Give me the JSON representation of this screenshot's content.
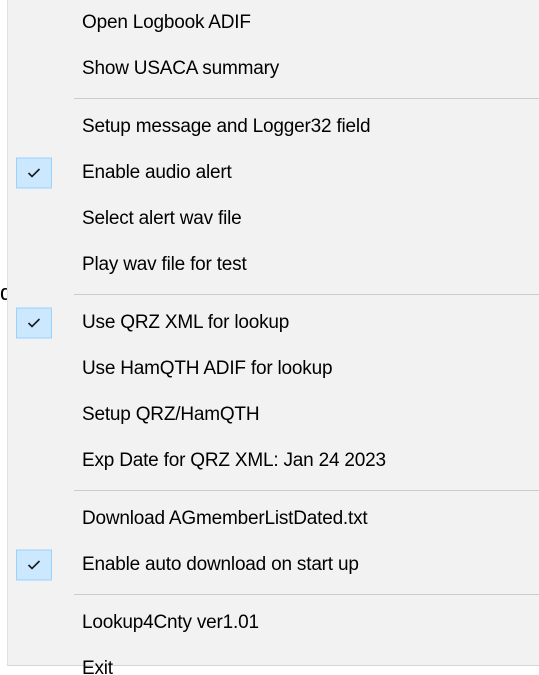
{
  "background": {
    "fragment_text": "d"
  },
  "menu": {
    "groups": [
      {
        "items": [
          {
            "label": "Open Logbook ADIF",
            "checked": false
          },
          {
            "label": "Show USACA summary",
            "checked": false
          }
        ]
      },
      {
        "items": [
          {
            "label": "Setup message and Logger32 field",
            "checked": false
          },
          {
            "label": "Enable audio alert",
            "checked": true
          },
          {
            "label": "Select alert wav file",
            "checked": false
          },
          {
            "label": "Play wav file for test",
            "checked": false
          }
        ]
      },
      {
        "items": [
          {
            "label": "Use QRZ XML for lookup",
            "checked": true
          },
          {
            "label": "Use HamQTH ADIF for lookup",
            "checked": false
          },
          {
            "label": "Setup QRZ/HamQTH",
            "checked": false
          },
          {
            "label": "Exp Date for QRZ XML: Jan 24 2023",
            "checked": false
          }
        ]
      },
      {
        "items": [
          {
            "label": "Download AGmemberListDated.txt",
            "checked": false
          },
          {
            "label": "Enable auto download on start up",
            "checked": true
          }
        ]
      },
      {
        "items": [
          {
            "label": "Lookup4Cnty ver1.01",
            "checked": false
          },
          {
            "label": "Exit",
            "checked": false
          }
        ]
      }
    ]
  },
  "icons": {
    "check": "checkmark-icon"
  },
  "colors": {
    "menu_background": "#f2f2f2",
    "check_background": "#cce8ff",
    "check_border": "#99d1ff",
    "separator": "#cccccc"
  }
}
